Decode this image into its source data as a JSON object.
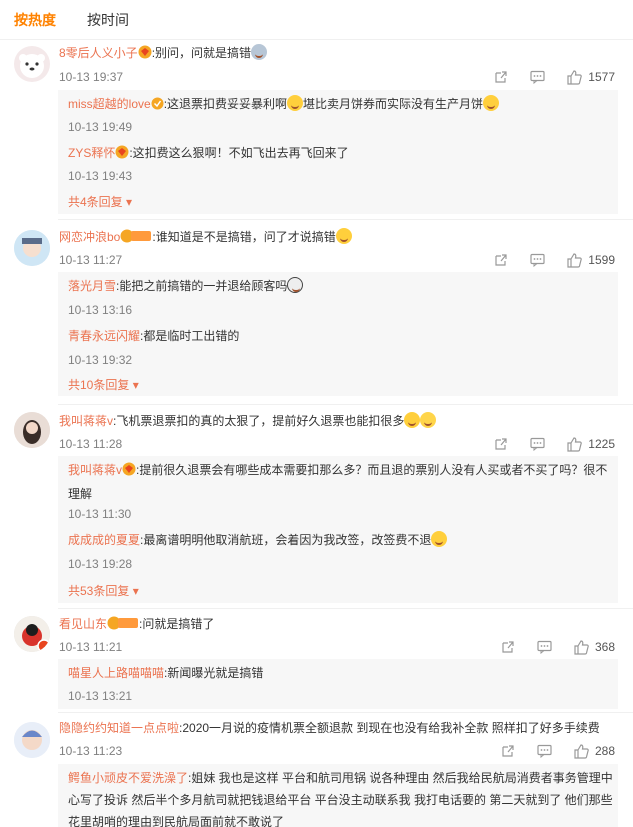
{
  "tabs": {
    "hot": "按热度",
    "time": "按时间"
  },
  "comments": [
    {
      "user": "8零后人义小子",
      "text": ":别问，问就是搞错",
      "time": "10-13 19:37",
      "likes": "1577",
      "replies": [
        {
          "user": "miss超越的love",
          "text": ":这退票扣费妥妥暴利啊",
          "text2": "堪比卖月饼券而实际没有生产月饼",
          "time": "10-13 19:49"
        },
        {
          "user": "ZYS释怀",
          "text": ":这扣费这么狠啊！不如飞出去再飞回来了",
          "time": "10-13 19:43"
        }
      ],
      "more": "共4条回复"
    },
    {
      "user": "网恋冲浪bo",
      "badge": "铁粉",
      "text": ":谁知道是不是搞错，问了才说搞错",
      "time": "10-13 11:27",
      "likes": "1599",
      "replies": [
        {
          "user": "落光月雪",
          "text": ":能把之前搞错的一并退给顾客吗",
          "time": "10-13 13:16"
        },
        {
          "user": "青春永远闪耀",
          "text": ":都是临时工出错的",
          "time": "10-13 19:32"
        }
      ],
      "more": "共10条回复"
    },
    {
      "user": "我叫蒋蒋v",
      "text": ":飞机票退票扣的真的太狠了，提前好久退票也能扣很多",
      "time": "10-13 11:28",
      "likes": "1225",
      "replies": [
        {
          "user": "我叫蒋蒋v",
          "text": ":提前很久退票会有哪些成本需要扣那么多？而且退的票别人没有人买或者不买了吗？很不理解",
          "time": "10-13 11:30"
        },
        {
          "user": "成成成的夏夏",
          "text": ":最离谱明明他取消航班，会着因为我改签，改签费不退",
          "time": "10-13 19:28"
        }
      ],
      "more": "共53条回复"
    },
    {
      "user": "看见山东",
      "badge": "铁粉",
      "text": ":问就是搞错了",
      "time": "10-13 11:21",
      "likes": "368",
      "replies": [
        {
          "user": "喵星人上路喵喵喵",
          "text": ":新闻曝光就是搞错",
          "time": "10-13 13:21"
        }
      ]
    },
    {
      "user": "隐隐约约知道一点点啦",
      "text": ":2020一月说的疫情机票全额退款 到现在也没有给我补全款 照样扣了好多手续费",
      "time": "10-13 11:23",
      "likes": "288",
      "replies": [
        {
          "user": "鳄鱼小顽皮不爱洗澡了",
          "text": ":姐妹 我也是这样 平台和航司甩锅 说各种理由 然后我给民航局消费者事务管理中心写了投诉 然后半个多月航司就把钱退给平台 平台没主动联系我 我打电话要的 第二天就到了 他们那些花里胡哨的理由到民航局面前就不敢说了"
        }
      ]
    }
  ],
  "colors": {
    "accent": "#ff8200",
    "username": "#eb7350",
    "meta": "#808080",
    "reply_bg": "#f7f7f7"
  },
  "icons": [
    "share-icon",
    "comment-icon",
    "like-icon",
    "chevron-down-icon",
    "verified-icon",
    "vip-icon"
  ]
}
